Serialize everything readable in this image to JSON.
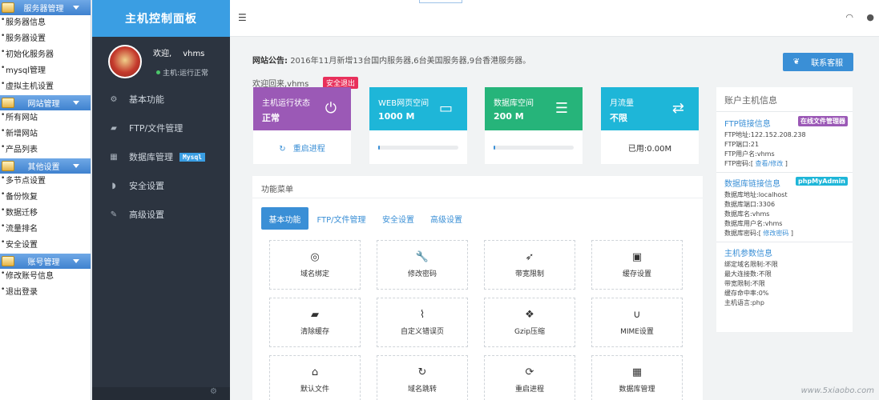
{
  "leftmenu": {
    "groups": [
      {
        "title": "服务器管理",
        "items": [
          "服务器信息",
          "服务器设置",
          "初始化服务器",
          "mysql管理",
          "虚拟主机设置"
        ]
      },
      {
        "title": "网站管理",
        "items": [
          "所有网站",
          "新增网站",
          "产品列表"
        ]
      },
      {
        "title": "其他设置",
        "items": [
          "多节点设置",
          "备份恢复",
          "数据迁移",
          "流量排名",
          "安全设置"
        ]
      },
      {
        "title": "账号管理",
        "items": [
          "修改账号信息",
          "退出登录"
        ]
      }
    ]
  },
  "sidebar": {
    "brand": "主机控制面板",
    "welcome": "欢迎,",
    "username": "vhms",
    "status": "主机:运行正常",
    "nav": [
      {
        "label": "基本功能",
        "icon": "gears-icon",
        "glyph": "⚙"
      },
      {
        "label": "FTP/文件管理",
        "icon": "folder-icon",
        "glyph": "▰"
      },
      {
        "label": "数据库管理",
        "icon": "table-icon",
        "glyph": "▦",
        "badge": "Mysql"
      },
      {
        "label": "安全设置",
        "icon": "shield-icon",
        "glyph": "◗"
      },
      {
        "label": "高级设置",
        "icon": "edit-icon",
        "glyph": "✎"
      }
    ]
  },
  "main": {
    "announce_label": "网站公告:",
    "announce_text": "2016年11月新增13台国内服务器,6台美国服务器,9台香港服务器。",
    "service_button": "联系客服",
    "welcome_back": "欢迎回来,vhms",
    "logout_label": "安全退出"
  },
  "stats": [
    {
      "label": "主机运行状态",
      "value": "正常",
      "color": "#9b59b6",
      "icon": "power-icon",
      "glyph": "⏻",
      "footer": "重启进程",
      "footer_icon": "↻"
    },
    {
      "label": "WEB网页空间",
      "value": "1000 M",
      "color": "#1eb6d8",
      "icon": "harddisk-icon",
      "glyph": "▭",
      "progress": 0.01
    },
    {
      "label": "数据库空间",
      "value": "200 M",
      "color": "#26b47a",
      "icon": "database-icon",
      "glyph": "☰",
      "progress": 0.01
    },
    {
      "label": "月流量",
      "value": "不限",
      "color": "#1eb6d8",
      "icon": "exchange-icon",
      "glyph": "⇄",
      "footer": "已用:0.00M"
    }
  ],
  "func": {
    "title": "功能菜单",
    "tabs": [
      "基本功能",
      "FTP/文件管理",
      "安全设置",
      "高级设置"
    ],
    "tiles": [
      {
        "label": "域名绑定",
        "icon": "globe-icon",
        "glyph": "◎"
      },
      {
        "label": "修改密码",
        "icon": "wrench-icon",
        "glyph": "🔧"
      },
      {
        "label": "带宽限制",
        "icon": "rocket-icon",
        "glyph": "➶"
      },
      {
        "label": "缓存设置",
        "icon": "floppy-icon",
        "glyph": "▣"
      },
      {
        "label": "清除缓存",
        "icon": "eraser-icon",
        "glyph": "▰"
      },
      {
        "label": "自定义错误页",
        "icon": "paperclip-icon",
        "glyph": "⌇"
      },
      {
        "label": "Gzip压缩",
        "icon": "dropbox-icon",
        "glyph": "❖"
      },
      {
        "label": "MIME设置",
        "icon": "magnet-icon",
        "glyph": "∪"
      },
      {
        "label": "默认文件",
        "icon": "home-icon",
        "glyph": "⌂"
      },
      {
        "label": "域名跳转",
        "icon": "redo-icon",
        "glyph": "↻"
      },
      {
        "label": "重启进程",
        "icon": "refresh-icon",
        "glyph": "⟳"
      },
      {
        "label": "数据库管理",
        "icon": "table-icon",
        "glyph": "▦"
      }
    ]
  },
  "account": {
    "title": "账户主机信息",
    "ftp": {
      "title": "FTP链接信息",
      "badge": "在线文件管理器",
      "badge_color": "#9b59b6",
      "lines": [
        "FTP地址:122.152.208.238",
        "FTP端口:21",
        "FTP用户名:vhms"
      ],
      "pwd_label": "FTP密码:[",
      "pwd_link": "查看/修改",
      "pwd_end": "]"
    },
    "db": {
      "title": "数据库链接信息",
      "badge": "phpMyAdmin",
      "badge_color": "#1eb6d8",
      "lines": [
        "数据库地址:localhost",
        "数据库端口:3306",
        "数据库名:vhms",
        "数据库用户名:vhms"
      ],
      "pwd_label": "数据库密码:[",
      "pwd_link": "修改密码",
      "pwd_end": "]"
    },
    "params": {
      "title": "主机参数信息",
      "lines": [
        "绑定域名限制:不限",
        "最大连接数:不限",
        "带宽限制:不限",
        "缓存命中率:0%",
        "主机语言:php"
      ]
    }
  },
  "watermark": "www.5xiaobo.com"
}
